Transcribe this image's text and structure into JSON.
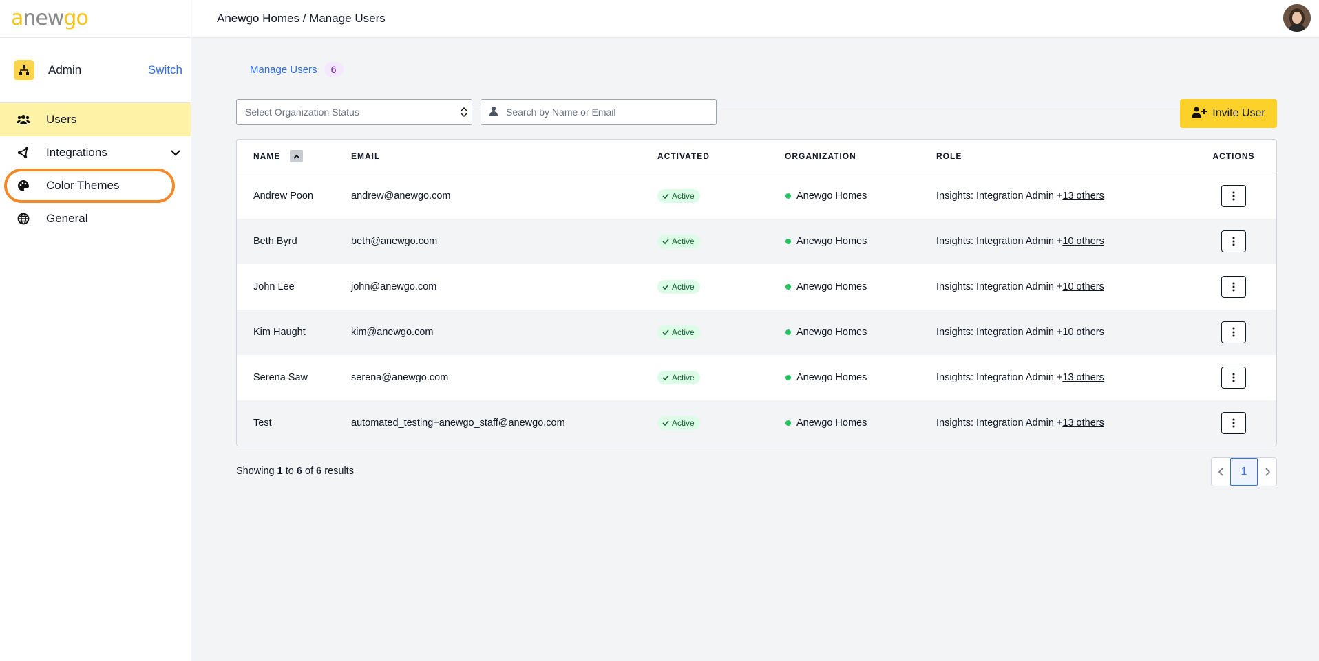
{
  "app": {
    "logo": {
      "part1": "a",
      "part2": "new",
      "part3": "go"
    }
  },
  "sidebar": {
    "context": {
      "label": "Admin",
      "switch_label": "Switch"
    },
    "items": [
      {
        "label": "Users",
        "icon": "users-icon",
        "active": true
      },
      {
        "label": "Integrations",
        "icon": "integrations-icon",
        "expandable": true
      },
      {
        "label": "Color Themes",
        "icon": "palette-icon",
        "highlighted": true
      },
      {
        "label": "General",
        "icon": "globe-icon"
      }
    ]
  },
  "header": {
    "breadcrumb": "Anewgo Homes / Manage Users"
  },
  "tabs": [
    {
      "label": "Manage Users",
      "count": "6"
    }
  ],
  "filters": {
    "status_placeholder": "Select Organization Status",
    "search_placeholder": "Search by Name or Email",
    "invite_label": "Invite User"
  },
  "table": {
    "headers": {
      "name": "NAME",
      "email": "EMAIL",
      "activated": "ACTIVATED",
      "organization": "ORGANIZATION",
      "role": "ROLE",
      "actions": "ACTIONS"
    },
    "rows": [
      {
        "name": "Andrew Poon",
        "email": "andrew@anewgo.com",
        "status": "Active",
        "org": "Anewgo Homes",
        "role": "Insights: Integration Admin +",
        "others": "13 others"
      },
      {
        "name": "Beth Byrd",
        "email": "beth@anewgo.com",
        "status": "Active",
        "org": "Anewgo Homes",
        "role": "Insights: Integration Admin +",
        "others": "10 others"
      },
      {
        "name": "John Lee",
        "email": "john@anewgo.com",
        "status": "Active",
        "org": "Anewgo Homes",
        "role": "Insights: Integration Admin +",
        "others": "10 others"
      },
      {
        "name": "Kim Haught",
        "email": "kim@anewgo.com",
        "status": "Active",
        "org": "Anewgo Homes",
        "role": "Insights: Integration Admin +",
        "others": "10 others"
      },
      {
        "name": "Serena Saw",
        "email": "serena@anewgo.com",
        "status": "Active",
        "org": "Anewgo Homes",
        "role": "Insights: Integration Admin +",
        "others": "13 others"
      },
      {
        "name": "Test",
        "email": "automated_testing+anewgo_staff@anewgo.com",
        "status": "Active",
        "org": "Anewgo Homes",
        "role": "Insights: Integration Admin +",
        "others": "13 others"
      }
    ]
  },
  "pagination": {
    "showing": "Showing",
    "from": "1",
    "to_word": "to",
    "to": "6",
    "of_word": "of",
    "total": "6",
    "results_word": "results",
    "current_page": "1"
  },
  "colors": {
    "accent": "#2f6fed",
    "brand_yellow": "#fcd12a",
    "active_nav": "#fdf2a6",
    "highlight_ring": "#f4892a",
    "status_green": "#22c55e"
  }
}
